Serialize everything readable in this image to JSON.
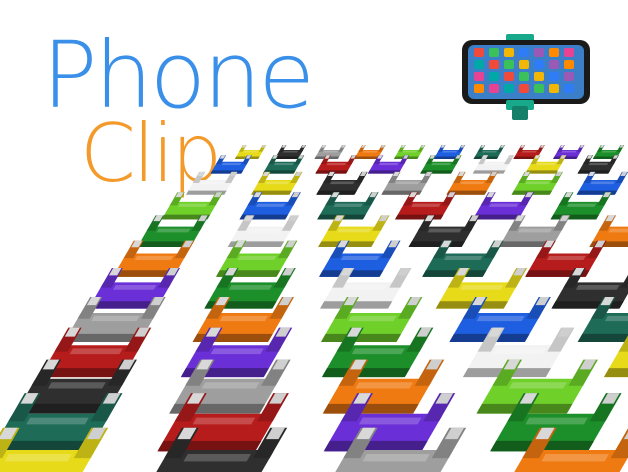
{
  "title": {
    "line1": "Phone",
    "line2": "Clip"
  },
  "colors": {
    "title_line1": "#3a8fe8",
    "title_line2": "#f39a2b",
    "clip_palette": [
      "#e6da19",
      "#1c8f2a",
      "#b71c1c",
      "#1e5ee0",
      "#f07a12",
      "#2f2f2f",
      "#f2f2f2",
      "#6a2fd6",
      "#1e6b58",
      "#6fd02a",
      "#9e9e9e"
    ],
    "phone_body": "#1a1a1a",
    "clip_on_phone": "#18a88a"
  },
  "scene": {
    "subject": "rows-of-phone-clips",
    "inset": "phone-in-clip"
  }
}
